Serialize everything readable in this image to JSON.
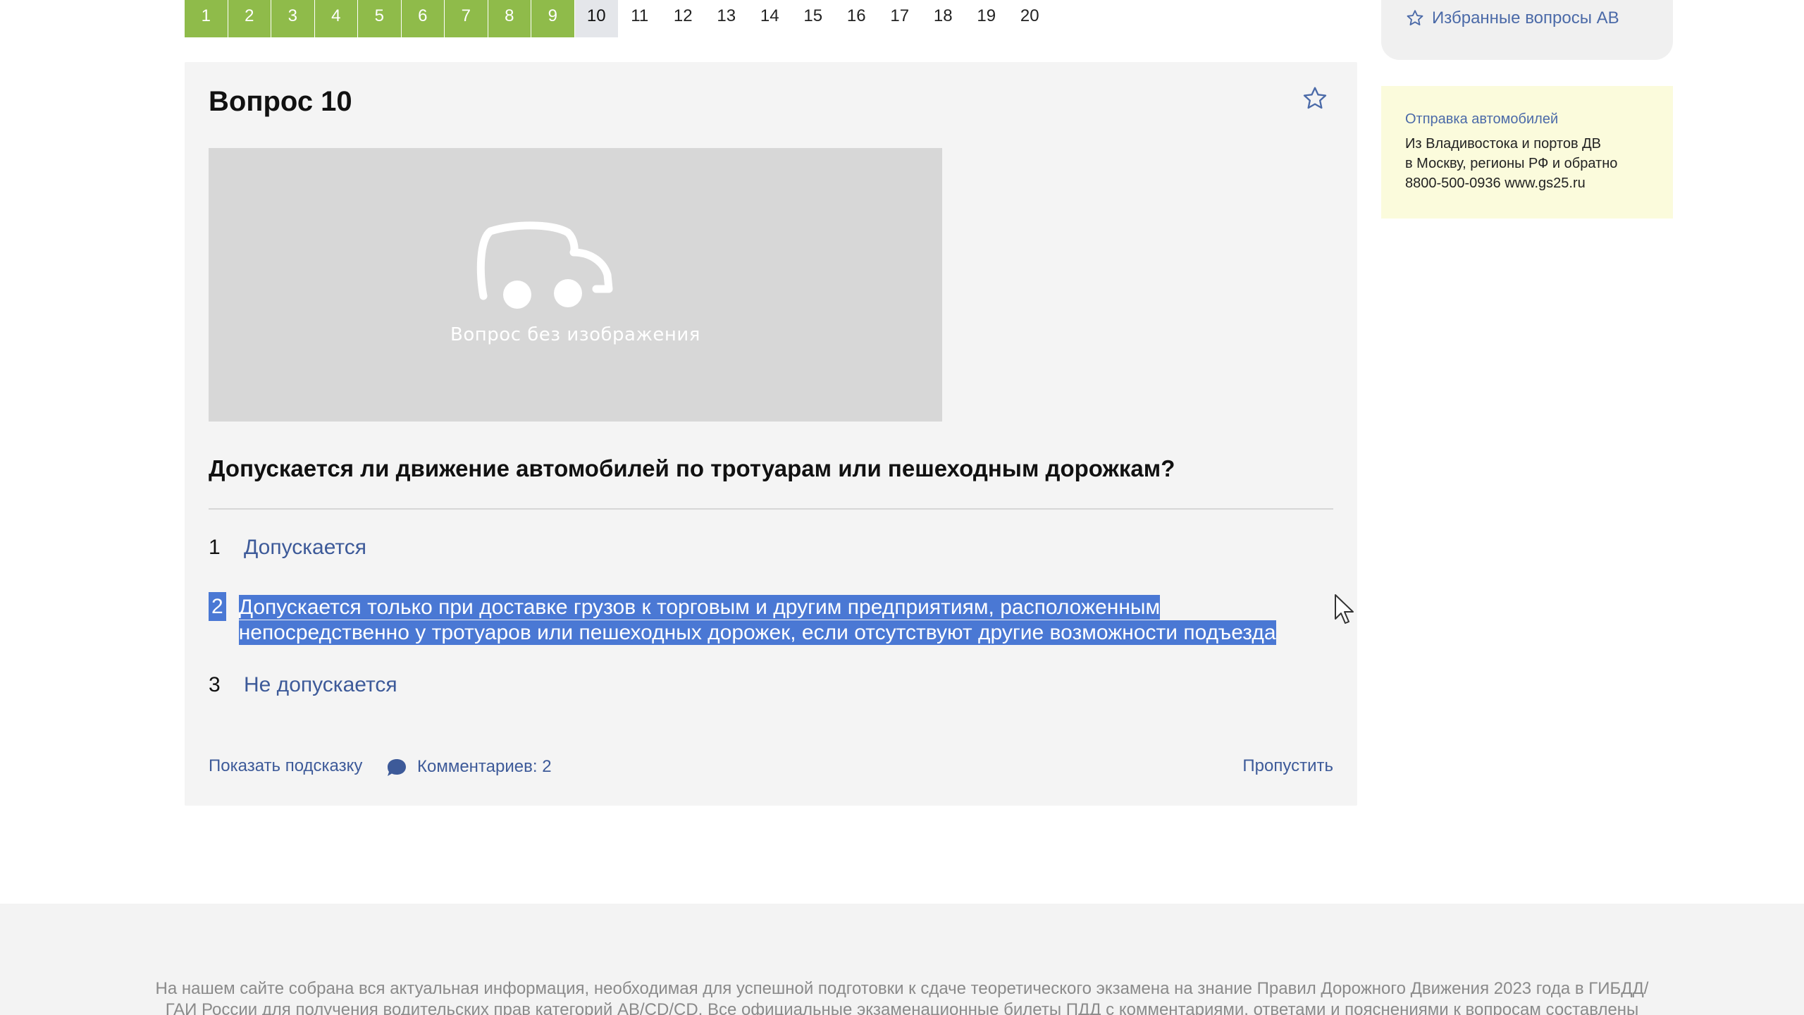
{
  "question_nav": [
    {
      "label": "1",
      "state": "done"
    },
    {
      "label": "2",
      "state": "done"
    },
    {
      "label": "3",
      "state": "done"
    },
    {
      "label": "4",
      "state": "done"
    },
    {
      "label": "5",
      "state": "done"
    },
    {
      "label": "6",
      "state": "done"
    },
    {
      "label": "7",
      "state": "done"
    },
    {
      "label": "8",
      "state": "done"
    },
    {
      "label": "9",
      "state": "done"
    },
    {
      "label": "10",
      "state": "current"
    },
    {
      "label": "11",
      "state": "pending"
    },
    {
      "label": "12",
      "state": "pending"
    },
    {
      "label": "13",
      "state": "pending"
    },
    {
      "label": "14",
      "state": "pending"
    },
    {
      "label": "15",
      "state": "pending"
    },
    {
      "label": "16",
      "state": "pending"
    },
    {
      "label": "17",
      "state": "pending"
    },
    {
      "label": "18",
      "state": "pending"
    },
    {
      "label": "19",
      "state": "pending"
    },
    {
      "label": "20",
      "state": "pending"
    }
  ],
  "question": {
    "title": "Вопрос 10",
    "image_placeholder_text": "Вопрос без изображения",
    "text": "Допускается ли движение автомобилей по тротуарам или пешеходным дорожкам?",
    "answers": [
      {
        "number": "1",
        "text": "Допускается"
      },
      {
        "number": "2",
        "text": "Допускается только при доставке грузов к торговым и другим предприятиям, расположенным непосредственно у тротуаров или пешеходных дорожек, если отсутствуют другие возможности подъезда"
      },
      {
        "number": "3",
        "text": "Не допускается"
      }
    ],
    "hint_label": "Показать подсказку",
    "comments_label": "Комментариев: 2",
    "skip_label": "Пропустить"
  },
  "sidebar": {
    "favorites_label": "Избранные вопросы АВ",
    "ad": {
      "title": "Отправка автомобилей",
      "line1": "Из Владивостока и портов ДВ",
      "line2": "в Москву, регионы РФ и обратно",
      "line3": "8800-500-0936 www.gs25.ru"
    }
  },
  "footer": {
    "text": "На нашем сайте собрана вся актуальная информация, необходимая для успешной подготовки к сдаче теоретического экзамена на знание Правил Дорожного Движения 2023 года в ГИБДД/ГАИ России для получения водительских прав категорий AB/CD/CD. Все официальные экзаменационные билеты ПДД с комментариями, ответами и пояснениями к вопросам составлены при"
  },
  "colors": {
    "done": "#8fbb4a",
    "current": "#e4e6ea",
    "link": "#3d5a99",
    "selection": "#4a78d4",
    "ad_background": "#fbfbdc"
  },
  "icons": {
    "favorite": "star-outline-icon",
    "comments": "speech-bubble-icon",
    "placeholder": "car-icon",
    "cursor": "mouse-pointer-icon"
  }
}
